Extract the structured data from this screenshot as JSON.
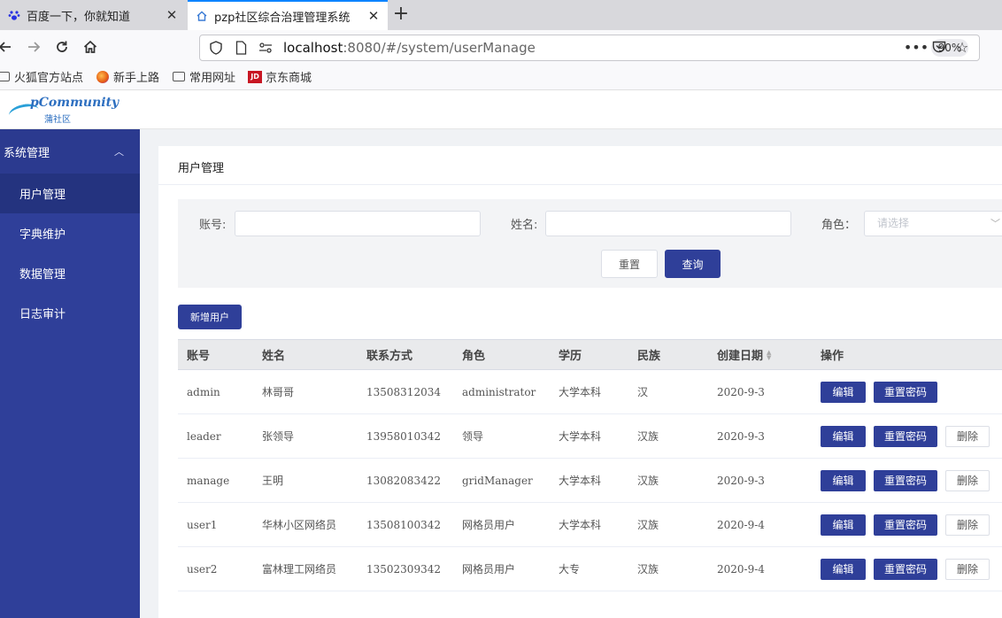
{
  "browser": {
    "tabs": [
      {
        "title": "百度一下，你就知道",
        "icon": "paw-icon",
        "active": false
      },
      {
        "title": "pzp社区综合治理管理系统",
        "icon": "home-icon",
        "active": true
      }
    ],
    "url_host": "localhost",
    "url_rest": ":8080/#/system/userManage",
    "zoom": "90%",
    "bookmarks": [
      "火狐官方站点",
      "新手上路",
      "常用网址",
      "京东商城"
    ],
    "jd_badge": "JD"
  },
  "app": {
    "logo_text": "pCommunity",
    "logo_sub": "蒲社区"
  },
  "sidebar": {
    "group": "系统管理",
    "items": [
      {
        "label": "用户管理",
        "active": true
      },
      {
        "label": "字典维护",
        "active": false
      },
      {
        "label": "数据管理",
        "active": false
      },
      {
        "label": "日志审计",
        "active": false
      }
    ]
  },
  "page": {
    "title": "用户管理",
    "search": {
      "account_label": "账号:",
      "name_label": "姓名:",
      "role_label": "角色：",
      "role_placeholder": "请选择",
      "reset_button": "重置",
      "query_button": "查询"
    },
    "add_button": "新增用户"
  },
  "table": {
    "headers": [
      "账号",
      "姓名",
      "联系方式",
      "角色",
      "学历",
      "民族",
      "创建日期",
      "操作"
    ],
    "rows": [
      {
        "account": "admin",
        "name": "林哥哥",
        "phone": "13508312034",
        "role": "administrator",
        "education": "大学本科",
        "ethnicity": "汉",
        "created": "2020-9-3",
        "deletable": false
      },
      {
        "account": "leader",
        "name": "张领导",
        "phone": "13958010342",
        "role": "领导",
        "education": "大学本科",
        "ethnicity": "汉族",
        "created": "2020-9-3",
        "deletable": true
      },
      {
        "account": "manage",
        "name": "王明",
        "phone": "13082083422",
        "role": "gridManager",
        "education": "大学本科",
        "ethnicity": "汉族",
        "created": "2020-9-3",
        "deletable": true
      },
      {
        "account": "user1",
        "name": "华林小区网络员",
        "phone": "13508100342",
        "role": "网格员用户",
        "education": "大学本科",
        "ethnicity": "汉族",
        "created": "2020-9-4",
        "deletable": true
      },
      {
        "account": "user2",
        "name": "富林理工网络员",
        "phone": "13502309342",
        "role": "网格员用户",
        "education": "大专",
        "ethnicity": "汉族",
        "created": "2020-9-4",
        "deletable": true
      }
    ],
    "actions": {
      "edit": "编辑",
      "reset_password": "重置密码",
      "delete": "删除"
    }
  },
  "colors": {
    "primary": "#2f3f99",
    "sidebar": "#2f3f99",
    "sidebar_active": "#24337f"
  }
}
